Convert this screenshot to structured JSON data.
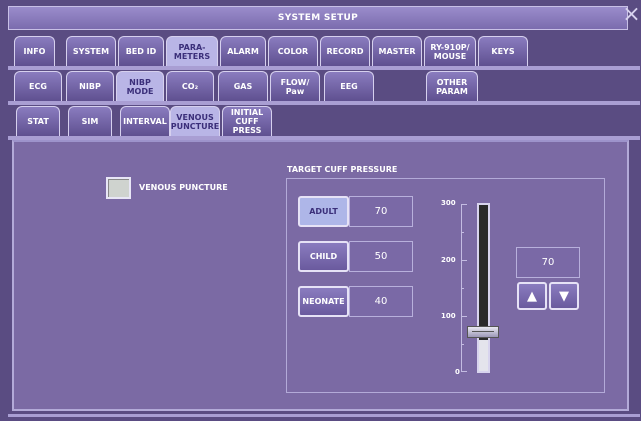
{
  "window": {
    "title": "SYSTEM SETUP",
    "close_glyph": "×"
  },
  "main_tabs": [
    {
      "label": "INFO"
    },
    {
      "label": "SYSTEM"
    },
    {
      "label": "BED ID"
    },
    {
      "label": "PARA-\nMETERS",
      "selected": true
    },
    {
      "label": "ALARM"
    },
    {
      "label": "COLOR"
    },
    {
      "label": "RECORD"
    },
    {
      "label": "MASTER"
    },
    {
      "label": "RY-910P/\nMOUSE"
    },
    {
      "label": "KEYS"
    }
  ],
  "param_tabs": [
    {
      "label": "ECG"
    },
    {
      "label": "NIBP"
    },
    {
      "label": "NIBP\nMODE",
      "selected": true
    },
    {
      "label": "CO₂"
    },
    {
      "label": "GAS"
    },
    {
      "label": "FLOW/\nPaw"
    },
    {
      "label": "EEG"
    },
    {
      "label": "OTHER\nPARAM"
    }
  ],
  "mode_tabs": [
    {
      "label": "STAT"
    },
    {
      "label": "SIM"
    },
    {
      "label": "INTERVAL"
    },
    {
      "label": "VENOUS\nPUNCTURE",
      "selected": true
    },
    {
      "label": "INITIAL\nCUFF\nPRESS"
    }
  ],
  "venous_puncture": {
    "label": "VENOUS PUNCTURE",
    "checked": false
  },
  "target_cuff": {
    "title": "TARGET CUFF PRESSURE",
    "presets": [
      {
        "label": "ADULT",
        "value": "70",
        "selected": true
      },
      {
        "label": "CHILD",
        "value": "50"
      },
      {
        "label": "NEONATE",
        "value": "40"
      }
    ],
    "scale": {
      "max_label": "300",
      "mid_label": "200",
      "low_label": "100",
      "min_label": "0",
      "max": 300,
      "value": 70
    },
    "readout": "70",
    "up_glyph": "▲",
    "down_glyph": "▼"
  },
  "colors": {
    "accent": "#7a6a9e",
    "selected_tab": "#b9b5e6"
  }
}
